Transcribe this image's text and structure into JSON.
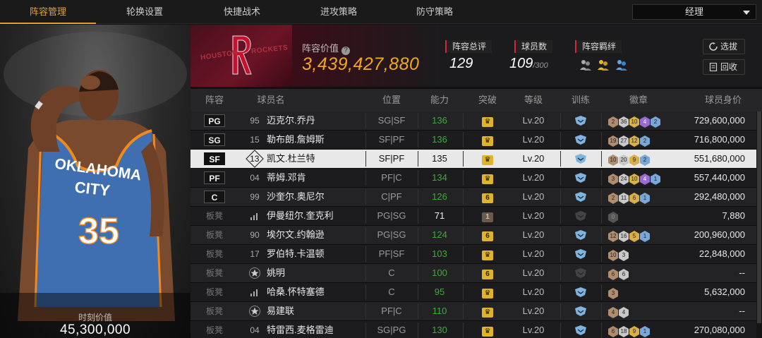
{
  "tabs": [
    {
      "label": "阵容管理",
      "active": true
    },
    {
      "label": "轮换设置",
      "active": false
    },
    {
      "label": "快捷战术",
      "active": false
    },
    {
      "label": "进攻策略",
      "active": false
    },
    {
      "label": "防守策略",
      "active": false
    }
  ],
  "role_select": {
    "value": "经理"
  },
  "player_card": {
    "jersey_team": "OKLAHOMA",
    "jersey_city": "CITY",
    "jersey_number": "35",
    "value_label": "时刻价值",
    "value": "45,300,000"
  },
  "team": {
    "logo_left": "HOUSTON",
    "logo_right": "ROCKETS",
    "value_label": "阵容价值",
    "value": "3,439,427,880"
  },
  "stats": {
    "rating_label": "阵容总评",
    "rating": "129",
    "players_label": "球员数",
    "players": "109",
    "players_max": "/300",
    "bond_label": "阵容羁绊",
    "bond_icons": [
      "bond-icon-grey",
      "bond-icon-gold",
      "bond-icon-blue"
    ]
  },
  "buttons": {
    "draft": "选拔",
    "recycle": "回收"
  },
  "columns": [
    "阵容",
    "球员名",
    "位置",
    "能力",
    "突破",
    "等级",
    "训练",
    "徽章",
    "球员身价"
  ],
  "rows": [
    {
      "pos": "PG",
      "bench": false,
      "num": "95",
      "name": "迈克尔.乔丹",
      "fpos": "SG|SF",
      "ability": "136",
      "green": true,
      "breakthrough": "crown",
      "level": "Lv.20",
      "train": "lit",
      "badges": [
        [
          "br",
          "2"
        ],
        [
          "si",
          "36"
        ],
        [
          "go",
          "10"
        ],
        [
          "pu",
          "4"
        ],
        [
          "bl",
          "2"
        ]
      ],
      "value": "729,600,000"
    },
    {
      "pos": "SG",
      "bench": false,
      "num": "15",
      "name": "勒布朗.詹姆斯",
      "fpos": "SF|PF",
      "ability": "136",
      "green": true,
      "breakthrough": "crown",
      "level": "Lv.20",
      "train": "lit",
      "badges": [
        [
          "br",
          "19"
        ],
        [
          "si",
          "27"
        ],
        [
          "go",
          "12"
        ],
        [
          "bl",
          "2"
        ]
      ],
      "value": "716,800,000"
    },
    {
      "pos": "SF",
      "bench": false,
      "selected": true,
      "num": "13",
      "name": "凯文.杜兰特",
      "fpos": "SF|PF",
      "ability": "135",
      "green": false,
      "breakthrough": "crown",
      "level": "Lv.20",
      "train": "lit",
      "badges": [
        [
          "br",
          "10"
        ],
        [
          "si",
          "20"
        ],
        [
          "go",
          "9"
        ],
        [
          "bl",
          "2"
        ]
      ],
      "value": "551,680,000"
    },
    {
      "pos": "PF",
      "bench": false,
      "num": "04",
      "name": "蒂姆.邓肯",
      "fpos": "PF|C",
      "ability": "134",
      "green": true,
      "breakthrough": "crown",
      "level": "Lv.20",
      "train": "lit",
      "badges": [
        [
          "br",
          "3"
        ],
        [
          "si",
          "24"
        ],
        [
          "go",
          "10"
        ],
        [
          "pu",
          "4"
        ],
        [
          "bl",
          "1"
        ]
      ],
      "value": "557,440,000"
    },
    {
      "pos": "C",
      "bench": false,
      "num": "99",
      "name": "沙奎尔.奥尼尔",
      "fpos": "C|PF",
      "ability": "126",
      "green": true,
      "breakthrough": "6",
      "level": "Lv.20",
      "train": "lit",
      "badges": [
        [
          "br",
          "2"
        ],
        [
          "si",
          "11"
        ],
        [
          "go",
          "6"
        ],
        [
          "bl",
          "1"
        ]
      ],
      "value": "292,480,000"
    },
    {
      "pos": "板凳",
      "bench": true,
      "num": "",
      "name": "伊曼纽尔.奎克利",
      "fpos": "PG|SG",
      "ability": "71",
      "green": false,
      "breakthrough": "1",
      "level": "Lv.20",
      "train": "dim",
      "badges": [
        [
          "dk",
          "0"
        ]
      ],
      "value": "7,880"
    },
    {
      "pos": "板凳",
      "bench": true,
      "num": "90",
      "name": "埃尔文.约翰逊",
      "fpos": "PG|SG",
      "ability": "124",
      "green": true,
      "breakthrough": "6",
      "level": "Lv.20",
      "train": "lit",
      "badges": [
        [
          "br",
          "12"
        ],
        [
          "si",
          "16"
        ],
        [
          "go",
          "5"
        ],
        [
          "bl",
          "1"
        ]
      ],
      "value": "200,960,000"
    },
    {
      "pos": "板凳",
      "bench": true,
      "num": "17",
      "name": "罗伯特.卡温顿",
      "fpos": "PF|SF",
      "ability": "103",
      "green": true,
      "breakthrough": "crown",
      "level": "Lv.20",
      "train": "lit",
      "badges": [
        [
          "br",
          "10"
        ],
        [
          "si",
          "3"
        ]
      ],
      "value": "22,848,000"
    },
    {
      "pos": "板凳",
      "bench": true,
      "num": "",
      "name": "姚明",
      "fpos": "C",
      "ability": "100",
      "green": true,
      "breakthrough": "6",
      "level": "Lv.20",
      "train": "dim",
      "badges": [
        [
          "br",
          "6"
        ],
        [
          "si",
          "6"
        ]
      ],
      "value": "--"
    },
    {
      "pos": "板凳",
      "bench": true,
      "num": "",
      "name": "哈桑.怀特塞德",
      "fpos": "C",
      "ability": "95",
      "green": true,
      "breakthrough": "crown",
      "level": "Lv.20",
      "train": "lit",
      "badges": [
        [
          "br",
          "3"
        ]
      ],
      "value": "5,632,000"
    },
    {
      "pos": "板凳",
      "bench": true,
      "num": "",
      "name": "易建联",
      "fpos": "PF|C",
      "ability": "110",
      "green": true,
      "breakthrough": "crown",
      "level": "Lv.20",
      "train": "lit",
      "badges": [
        [
          "br",
          "4"
        ],
        [
          "si",
          "4"
        ]
      ],
      "value": "--"
    },
    {
      "pos": "板凳",
      "bench": true,
      "num": "04",
      "name": "特雷西.麦格雷迪",
      "fpos": "SG|PG",
      "ability": "130",
      "green": true,
      "breakthrough": "crown",
      "level": "Lv.20",
      "train": "lit",
      "badges": [
        [
          "br",
          "6"
        ],
        [
          "si",
          "18"
        ],
        [
          "go",
          "9"
        ],
        [
          "bl",
          "1"
        ]
      ],
      "value": "270,080,000"
    }
  ]
}
